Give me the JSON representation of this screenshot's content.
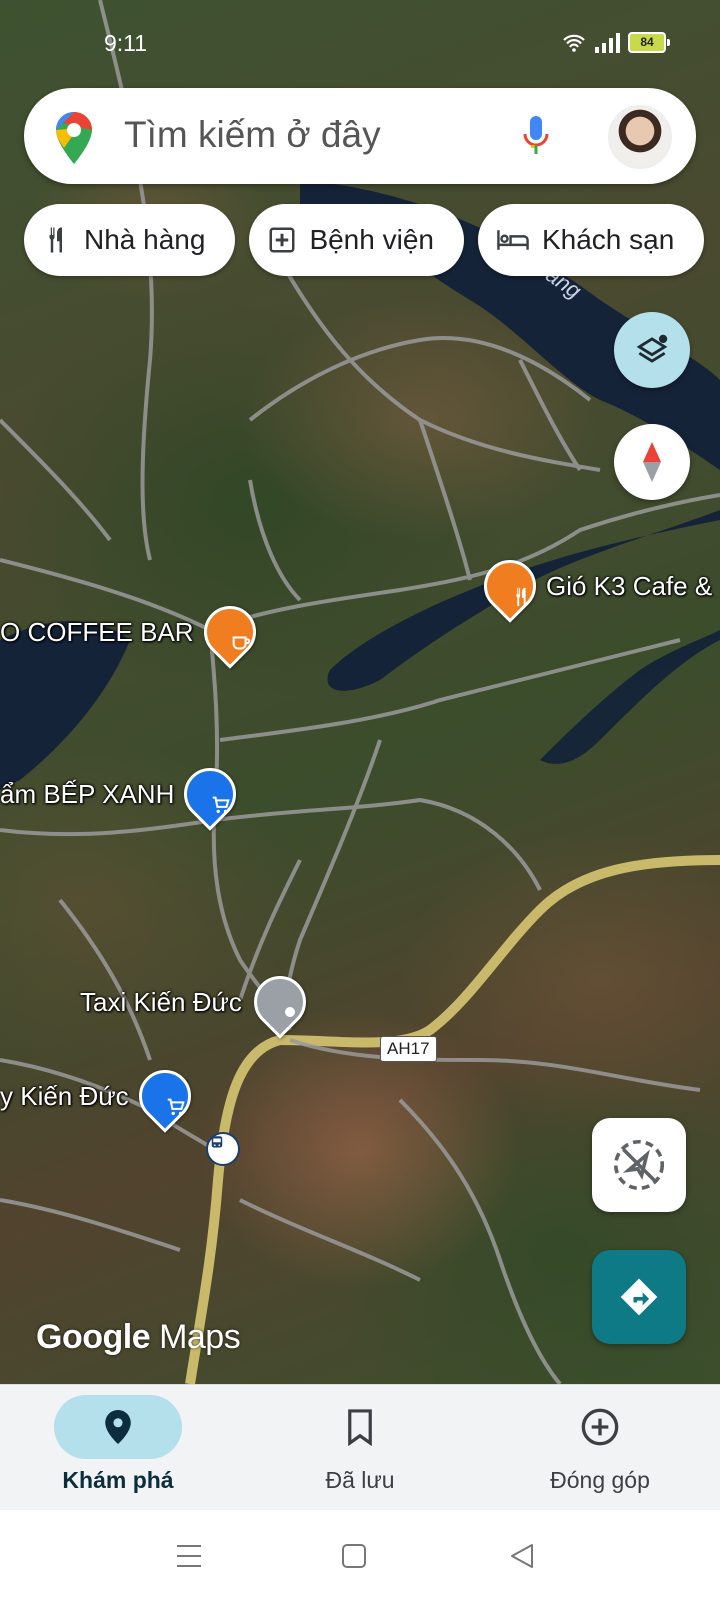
{
  "status_bar": {
    "time": "9:11",
    "battery": "84"
  },
  "search": {
    "placeholder": "Tìm kiếm ở đây"
  },
  "chips": [
    {
      "label": "Nhà hàng",
      "icon": "restaurant-icon"
    },
    {
      "label": "Bệnh viện",
      "icon": "hospital-icon"
    },
    {
      "label": "Khách sạn",
      "icon": "hotel-icon"
    }
  ],
  "map": {
    "places": [
      {
        "label": "Gió K3 Cafe &",
        "icon": "restaurant-icon",
        "color": "#f07d1f"
      },
      {
        "label": "O COFFEE BAR",
        "icon": "cafe-icon",
        "color": "#f07d1f"
      },
      {
        "label": "ẩm BẾP XANH",
        "icon": "shopping-cart-icon",
        "color": "#1a73e8"
      },
      {
        "label": "Taxi Kiến Đức",
        "icon": "pin-icon",
        "color": "#9aa0a6"
      },
      {
        "label": "y Kiến Đức",
        "icon": "shopping-cart-icon",
        "color": "#1a73e8"
      }
    ],
    "road_shield": "AH17",
    "river_label": "ang",
    "wordmark_google": "Google",
    "wordmark_maps": "Maps"
  },
  "bottom_nav": [
    {
      "label": "Khám phá",
      "icon": "explore-pin-icon",
      "active": true
    },
    {
      "label": "Đã lưu",
      "icon": "bookmark-icon",
      "active": false
    },
    {
      "label": "Đóng góp",
      "icon": "add-circle-icon",
      "active": false
    }
  ],
  "colors": {
    "accent": "#0d7a86",
    "active_nav": "#b3e0eb",
    "restaurant": "#f07d1f",
    "shop": "#1a73e8"
  }
}
